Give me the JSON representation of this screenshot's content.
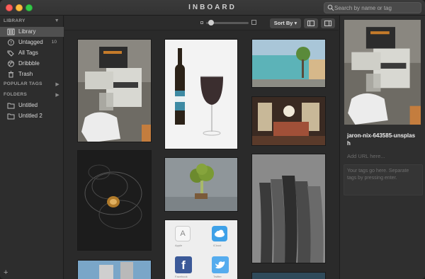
{
  "window": {
    "title": "INBOARD"
  },
  "search": {
    "placeholder": "Search by name or tag"
  },
  "sidebar": {
    "library_header": "LIBRARY",
    "items": [
      {
        "label": "Library",
        "icon": "library-icon",
        "active": true
      },
      {
        "label": "Untagged",
        "icon": "question-icon",
        "count": "10"
      },
      {
        "label": "All Tags",
        "icon": "tags-icon"
      },
      {
        "label": "Dribbble",
        "icon": "dribbble-icon"
      },
      {
        "label": "Trash",
        "icon": "trash-icon"
      }
    ],
    "popular_header": "POPULAR TAGS",
    "folders_header": "FOLDERS",
    "folders": [
      {
        "label": "Untitled",
        "icon": "folder-icon"
      },
      {
        "label": "Untitled 2",
        "icon": "folder-icon"
      }
    ],
    "add_label": "+"
  },
  "toolbar": {
    "sort_label": "Sort By ▾",
    "view_icons": [
      "sidebar-left-icon",
      "sidebar-right-icon"
    ]
  },
  "grid": {
    "app_labels": [
      "Apple",
      "iCloud",
      "Facebook",
      "Twitter"
    ]
  },
  "detail": {
    "name": "jaron-nix-643585-unsplash",
    "url_placeholder": "Add URL here...",
    "tags_placeholder": "Your tags go here. Separate tags by pressing enter."
  },
  "colors": {
    "close": "#fc605c",
    "minimize": "#fdbc40",
    "maximize": "#34c84a",
    "active_item": "#505050"
  }
}
